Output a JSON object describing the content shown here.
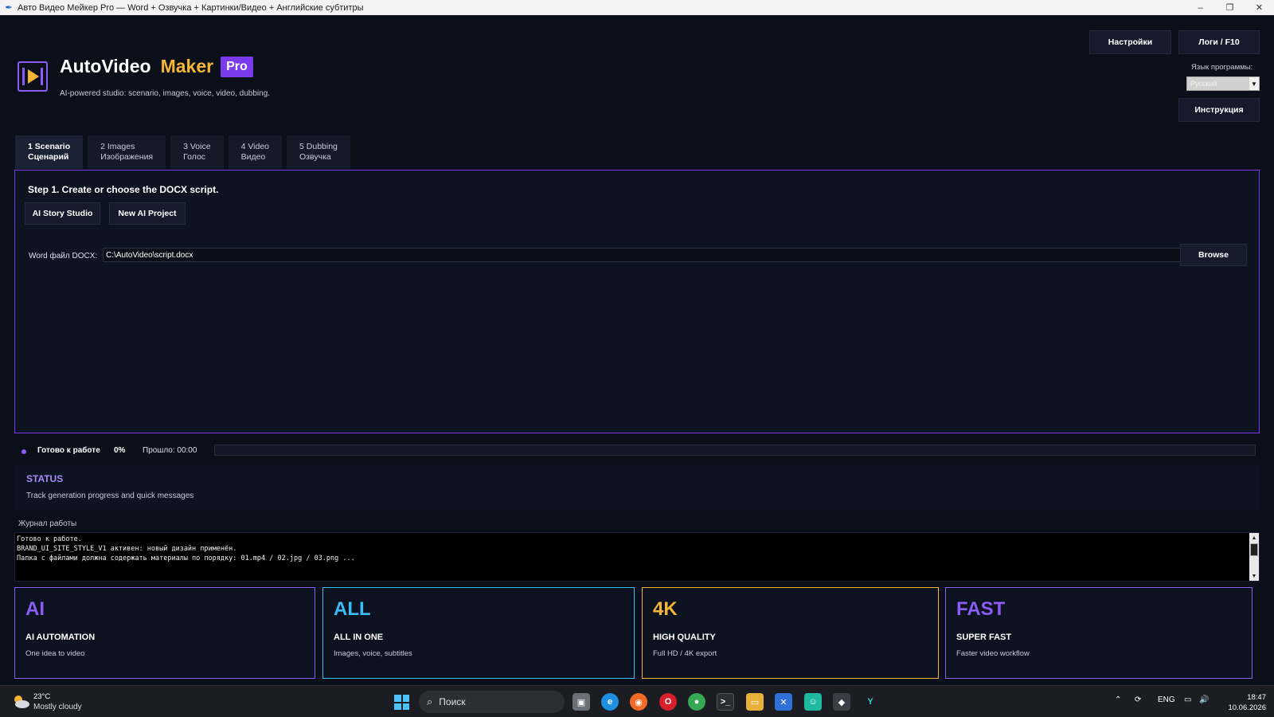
{
  "window": {
    "title": "Авто Видео Мейкер Pro — Word + Озвучка + Картинки/Видео + Английские субтитры",
    "min_glyph": "–",
    "max_glyph": "❐",
    "close_glyph": "✕"
  },
  "header": {
    "brand_word1": "AutoVideo",
    "brand_word2": "Maker",
    "brand_badge": "Pro",
    "tagline": "AI-powered studio: scenario, images, voice, video, dubbing.",
    "settings_label": "Настройки",
    "logs_label": "Логи / F10",
    "lang_label": "Язык программы:",
    "lang_value": "Русский",
    "instructions_label": "Инструкция"
  },
  "tabs": [
    {
      "line1": "1 Scenario",
      "line2": "Сценарий"
    },
    {
      "line1": "2 Images",
      "line2": "Изображения"
    },
    {
      "line1": "3 Voice",
      "line2": "Голос"
    },
    {
      "line1": "4 Video",
      "line2": "Видео"
    },
    {
      "line1": "5 Dubbing",
      "line2": "Озвучка"
    }
  ],
  "panel": {
    "step_title": "Step 1. Create or choose the DOCX script.",
    "ai_story_label": "AI Story Studio",
    "new_project_label": "New AI Project",
    "file_label": "Word файл DOCX:",
    "file_value": "C:\\AutoVideo\\script.docx",
    "browse_label": "Browse"
  },
  "status_row": {
    "text": "Готово к работе",
    "percent_text": "0%",
    "progress": 0,
    "elapsed": "Прошло: 00:00"
  },
  "status_box": {
    "heading": "STATUS",
    "subtitle": "Track generation progress and quick messages"
  },
  "log": {
    "label": "Журнал работы",
    "lines": "Готово к работе.\nBRAND_UI_SITE_STYLE_V1 активен: новый дизайн применён.\nПапка с файлами должна содержать материалы по порядку: 01.mp4 / 02.jpg / 03.png ..."
  },
  "cards": [
    {
      "big": "AI",
      "sub": "AI AUTOMATION",
      "desc": "One idea to video",
      "color": "#8b5cf6"
    },
    {
      "big": "ALL",
      "sub": "ALL IN ONE",
      "desc": "Images, voice, subtitles",
      "color": "#38bdf8"
    },
    {
      "big": "4K",
      "sub": "HIGH QUALITY",
      "desc": "Full HD / 4K export",
      "color": "#f5b638"
    },
    {
      "big": "FAST",
      "sub": "SUPER FAST",
      "desc": "Faster video workflow",
      "color": "#8b5cf6"
    }
  ],
  "taskbar": {
    "temp": "23°C",
    "condition": "Mostly cloudy",
    "search_placeholder": "Поиск",
    "lang": "ENG",
    "time": "18:47",
    "date": "10.06.2026"
  }
}
